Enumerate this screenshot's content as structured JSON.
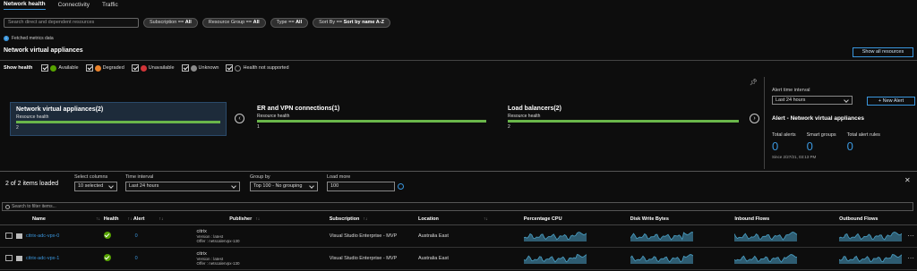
{
  "tabs": [
    "Network health",
    "Connectivity",
    "Traffic"
  ],
  "filters": {
    "search_placeholder": "Search direct and dependent resources",
    "pills": [
      {
        "key": "Subscription == ",
        "val": "All"
      },
      {
        "key": "Resource Group == ",
        "val": "All"
      },
      {
        "key": "Type == ",
        "val": "All"
      },
      {
        "key": "Sort By == ",
        "val": "Sort by name A-Z"
      }
    ]
  },
  "info": "Fetched metrics data",
  "section_title": "Network virtual appliances",
  "show_all": "Show all resources",
  "health": {
    "label": "Show health",
    "items": [
      {
        "label": "Available",
        "color": "#57a300",
        "checked": true
      },
      {
        "label": "Degraded",
        "color": "#e9822b",
        "checked": true
      },
      {
        "label": "Unavailable",
        "color": "#d13438",
        "checked": true
      },
      {
        "label": "Unknown",
        "color": "#8a8a8a",
        "checked": true
      },
      {
        "label": "Health not supported",
        "color": "#555555",
        "checked": true
      }
    ]
  },
  "cards": [
    {
      "title": "Network virtual appliances(2)",
      "sub": "Resource health",
      "count": "2"
    },
    {
      "title": "ER and VPN connections(1)",
      "sub": "Resource health",
      "count": "1"
    },
    {
      "title": "Load balancers(2)",
      "sub": "Resource health",
      "count": "2"
    }
  ],
  "alert": {
    "interval_label": "Alert time interval",
    "interval_value": "Last 24 hours",
    "new_alert": "+ New Alert",
    "title": "Alert - Network virtual appliances",
    "stats": [
      {
        "k": "Total alerts",
        "v": "0"
      },
      {
        "k": "Smart groups",
        "v": "0"
      },
      {
        "k": "Total alert rules",
        "v": "0"
      }
    ],
    "since": "Since 2/27/21, 03:13 PM"
  },
  "items_loaded": "2 of 2 items loaded",
  "controls": {
    "columns_label": "Select columns",
    "columns_value": "10 selected",
    "interval_label": "Time interval",
    "interval_value": "Last 24 hours",
    "group_label": "Group by",
    "group_value": "Top 100 - No grouping",
    "load_label": "Load more",
    "load_value": "100"
  },
  "filter_placeholder": "Search to filter items...",
  "table": {
    "headers": [
      "Name",
      "Health",
      "Alert",
      "Publisher",
      "Subscription",
      "Location",
      "Percentage CPU",
      "Disk Write Bytes",
      "Inbound Flows",
      "Outbound Flows"
    ],
    "rows": [
      {
        "name": "citrix-adc-vpx-0",
        "alert": "0",
        "publisher": "citrix",
        "version": "Version : latest",
        "offer": "Offer : netscalervpx-130",
        "subscription": "Visual Studio Enterprise - MVP",
        "location": "Australia East"
      },
      {
        "name": "citrix-adc-vpx-1",
        "alert": "0",
        "publisher": "citrix",
        "version": "Version : latest",
        "offer": "Offer : netscalervpx-130",
        "subscription": "Visual Studio Enterprise - MVP",
        "location": "Australia East"
      }
    ]
  },
  "colors": {
    "accent": "#3a96dd",
    "healthy": "#57a300",
    "spark": "#4a9fc4"
  }
}
